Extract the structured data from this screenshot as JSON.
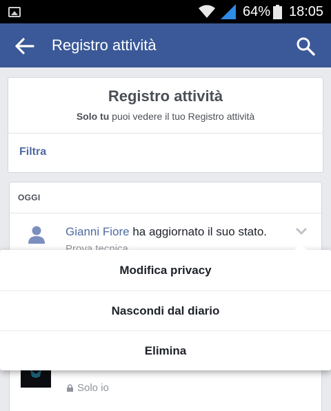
{
  "status_bar": {
    "battery_percent": "64%",
    "time": "18:05",
    "icons": [
      "gallery-icon",
      "wifi-icon",
      "signal-icon",
      "battery-icon"
    ]
  },
  "nav": {
    "title": "Registro attività",
    "back_icon": "back-arrow-icon",
    "search_icon": "search-icon"
  },
  "header": {
    "title": "Registro attività",
    "subtitle_bold": "Solo tu",
    "subtitle_rest": " puoi vedere il tuo Registro attività",
    "filter_label": "Filtra"
  },
  "activity": {
    "section_label": "OGGI",
    "items": [
      {
        "actor": "Gianni Fiore",
        "action": " ha aggiornato il suo stato.",
        "snippet": "Prova tecnica"
      }
    ],
    "second_item_privacy": "Solo io"
  },
  "menu": {
    "items": [
      {
        "label": "Modifica privacy"
      },
      {
        "label": "Nascondi dal diario"
      },
      {
        "label": "Elimina"
      }
    ]
  },
  "colors": {
    "brand": "#3b5998",
    "link": "#4e69a2",
    "background": "#e9eaed"
  }
}
